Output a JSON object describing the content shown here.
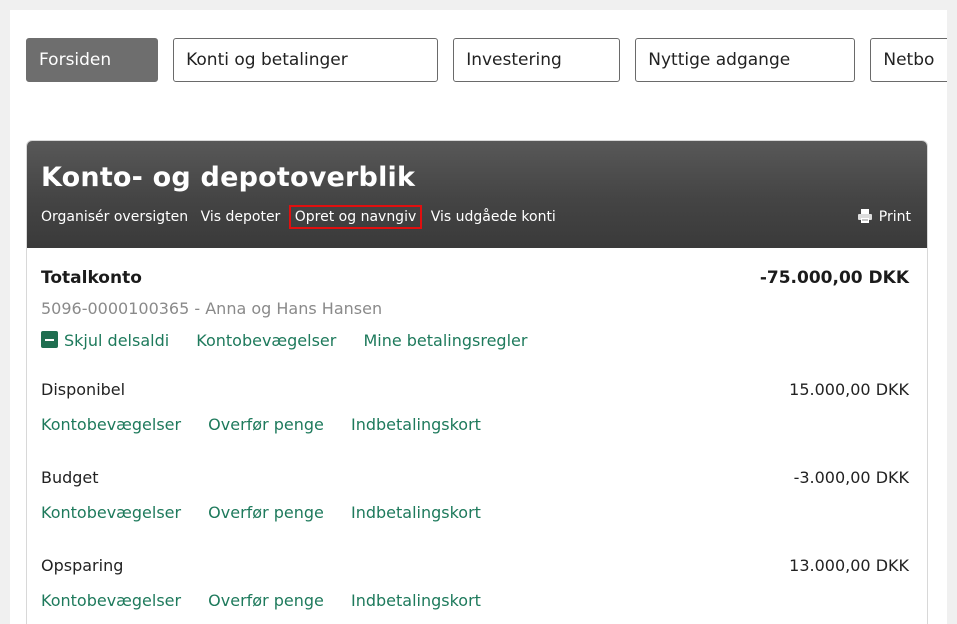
{
  "nav": {
    "tabs": [
      {
        "label": "Forsiden",
        "active": true
      },
      {
        "label": "Konti og betalinger",
        "active": false
      },
      {
        "label": "Investering",
        "active": false
      },
      {
        "label": "Nyttige adgange",
        "active": false
      },
      {
        "label": "Netbo",
        "active": false
      }
    ]
  },
  "overview": {
    "title": "Konto- og depotoverblik",
    "subnav": [
      "Organisér oversigten",
      "Vis depoter",
      "Opret og navngiv",
      "Vis udgåede konti"
    ],
    "print_label": "Print",
    "highlight_color": "#e10f0f"
  },
  "account": {
    "name": "Totalkonto",
    "amount": "-75.000,00 DKK",
    "info": "5096-0000100365 - Anna og Hans Hansen",
    "actions": {
      "hide_subbalance": "Skjul delsaldi",
      "movements": "Kontobevægelser",
      "payment_rules": "Mine betalingsregler"
    },
    "subaccounts": [
      {
        "label": "Disponibel",
        "amount": "15.000,00 DKK",
        "links": [
          "Kontobevægelser",
          "Overfør penge",
          "Indbetalingskort"
        ]
      },
      {
        "label": "Budget",
        "amount": "-3.000,00 DKK",
        "links": [
          "Kontobevægelser",
          "Overfør penge",
          "Indbetalingskort"
        ]
      },
      {
        "label": "Opsparing",
        "amount": "13.000,00 DKK",
        "links": [
          "Kontobevægelser",
          "Overfør penge",
          "Indbetalingskort"
        ]
      }
    ]
  },
  "colors": {
    "link": "#1e7a5c",
    "header_dark": "#444444",
    "active_tab": "#6e6e6e"
  }
}
